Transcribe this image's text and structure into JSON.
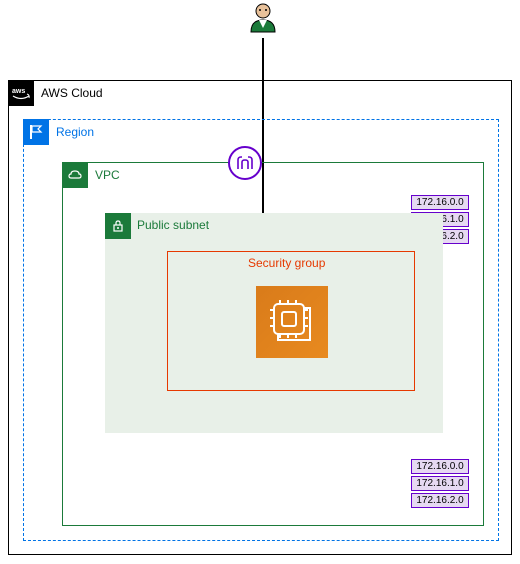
{
  "aws_cloud": {
    "label": "AWS Cloud"
  },
  "region": {
    "label": "Region"
  },
  "vpc": {
    "label": "VPC"
  },
  "public_subnet": {
    "label": "Public subnet"
  },
  "security_group": {
    "label": "Security group"
  },
  "cidr_blocks_top": [
    "172.16.0.0",
    "172.16.1.0",
    "172.16.2.0"
  ],
  "cidr_blocks_bottom": [
    "172.16.0.0",
    "172.16.1.0",
    "172.16.2.0"
  ]
}
